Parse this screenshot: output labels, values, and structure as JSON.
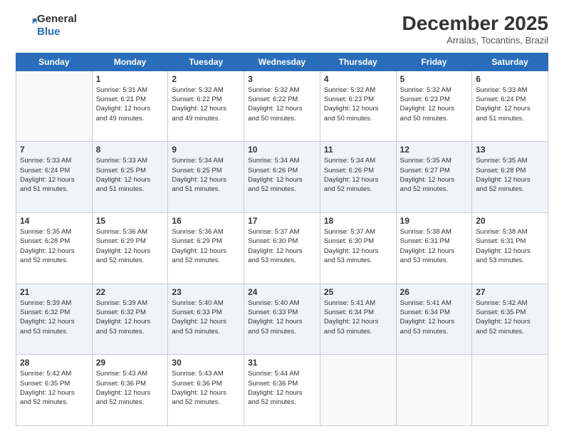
{
  "header": {
    "logo_line1": "General",
    "logo_line2": "Blue",
    "month": "December 2025",
    "location": "Arraias, Tocantins, Brazil"
  },
  "days_of_week": [
    "Sunday",
    "Monday",
    "Tuesday",
    "Wednesday",
    "Thursday",
    "Friday",
    "Saturday"
  ],
  "weeks": [
    [
      {
        "num": "",
        "text": ""
      },
      {
        "num": "1",
        "text": "Sunrise: 5:31 AM\nSunset: 6:21 PM\nDaylight: 12 hours\nand 49 minutes."
      },
      {
        "num": "2",
        "text": "Sunrise: 5:32 AM\nSunset: 6:22 PM\nDaylight: 12 hours\nand 49 minutes."
      },
      {
        "num": "3",
        "text": "Sunrise: 5:32 AM\nSunset: 6:22 PM\nDaylight: 12 hours\nand 50 minutes."
      },
      {
        "num": "4",
        "text": "Sunrise: 5:32 AM\nSunset: 6:23 PM\nDaylight: 12 hours\nand 50 minutes."
      },
      {
        "num": "5",
        "text": "Sunrise: 5:32 AM\nSunset: 6:23 PM\nDaylight: 12 hours\nand 50 minutes."
      },
      {
        "num": "6",
        "text": "Sunrise: 5:33 AM\nSunset: 6:24 PM\nDaylight: 12 hours\nand 51 minutes."
      }
    ],
    [
      {
        "num": "7",
        "text": "Sunrise: 5:33 AM\nSunset: 6:24 PM\nDaylight: 12 hours\nand 51 minutes."
      },
      {
        "num": "8",
        "text": "Sunrise: 5:33 AM\nSunset: 6:25 PM\nDaylight: 12 hours\nand 51 minutes."
      },
      {
        "num": "9",
        "text": "Sunrise: 5:34 AM\nSunset: 6:25 PM\nDaylight: 12 hours\nand 51 minutes."
      },
      {
        "num": "10",
        "text": "Sunrise: 5:34 AM\nSunset: 6:26 PM\nDaylight: 12 hours\nand 52 minutes."
      },
      {
        "num": "11",
        "text": "Sunrise: 5:34 AM\nSunset: 6:26 PM\nDaylight: 12 hours\nand 52 minutes."
      },
      {
        "num": "12",
        "text": "Sunrise: 5:35 AM\nSunset: 6:27 PM\nDaylight: 12 hours\nand 52 minutes."
      },
      {
        "num": "13",
        "text": "Sunrise: 5:35 AM\nSunset: 6:28 PM\nDaylight: 12 hours\nand 52 minutes."
      }
    ],
    [
      {
        "num": "14",
        "text": "Sunrise: 5:35 AM\nSunset: 6:28 PM\nDaylight: 12 hours\nand 52 minutes."
      },
      {
        "num": "15",
        "text": "Sunrise: 5:36 AM\nSunset: 6:29 PM\nDaylight: 12 hours\nand 52 minutes."
      },
      {
        "num": "16",
        "text": "Sunrise: 5:36 AM\nSunset: 6:29 PM\nDaylight: 12 hours\nand 52 minutes."
      },
      {
        "num": "17",
        "text": "Sunrise: 5:37 AM\nSunset: 6:30 PM\nDaylight: 12 hours\nand 53 minutes."
      },
      {
        "num": "18",
        "text": "Sunrise: 5:37 AM\nSunset: 6:30 PM\nDaylight: 12 hours\nand 53 minutes."
      },
      {
        "num": "19",
        "text": "Sunrise: 5:38 AM\nSunset: 6:31 PM\nDaylight: 12 hours\nand 53 minutes."
      },
      {
        "num": "20",
        "text": "Sunrise: 5:38 AM\nSunset: 6:31 PM\nDaylight: 12 hours\nand 53 minutes."
      }
    ],
    [
      {
        "num": "21",
        "text": "Sunrise: 5:39 AM\nSunset: 6:32 PM\nDaylight: 12 hours\nand 53 minutes."
      },
      {
        "num": "22",
        "text": "Sunrise: 5:39 AM\nSunset: 6:32 PM\nDaylight: 12 hours\nand 53 minutes."
      },
      {
        "num": "23",
        "text": "Sunrise: 5:40 AM\nSunset: 6:33 PM\nDaylight: 12 hours\nand 53 minutes."
      },
      {
        "num": "24",
        "text": "Sunrise: 5:40 AM\nSunset: 6:33 PM\nDaylight: 12 hours\nand 53 minutes."
      },
      {
        "num": "25",
        "text": "Sunrise: 5:41 AM\nSunset: 6:34 PM\nDaylight: 12 hours\nand 53 minutes."
      },
      {
        "num": "26",
        "text": "Sunrise: 5:41 AM\nSunset: 6:34 PM\nDaylight: 12 hours\nand 53 minutes."
      },
      {
        "num": "27",
        "text": "Sunrise: 5:42 AM\nSunset: 6:35 PM\nDaylight: 12 hours\nand 52 minutes."
      }
    ],
    [
      {
        "num": "28",
        "text": "Sunrise: 5:42 AM\nSunset: 6:35 PM\nDaylight: 12 hours\nand 52 minutes."
      },
      {
        "num": "29",
        "text": "Sunrise: 5:43 AM\nSunset: 6:36 PM\nDaylight: 12 hours\nand 52 minutes."
      },
      {
        "num": "30",
        "text": "Sunrise: 5:43 AM\nSunset: 6:36 PM\nDaylight: 12 hours\nand 52 minutes."
      },
      {
        "num": "31",
        "text": "Sunrise: 5:44 AM\nSunset: 6:36 PM\nDaylight: 12 hours\nand 52 minutes."
      },
      {
        "num": "",
        "text": ""
      },
      {
        "num": "",
        "text": ""
      },
      {
        "num": "",
        "text": ""
      }
    ]
  ]
}
